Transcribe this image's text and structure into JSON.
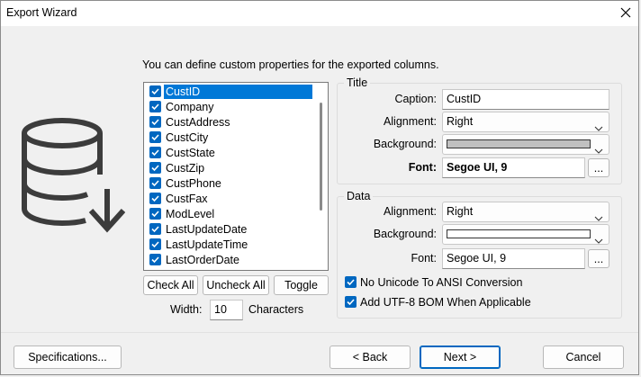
{
  "window": {
    "title": "Export Wizard"
  },
  "intro_text": "You can define custom properties for the exported columns.",
  "columns": [
    {
      "label": "CustID",
      "checked": true,
      "selected": true
    },
    {
      "label": "Company",
      "checked": true
    },
    {
      "label": "CustAddress",
      "checked": true
    },
    {
      "label": "CustCity",
      "checked": true
    },
    {
      "label": "CustState",
      "checked": true
    },
    {
      "label": "CustZip",
      "checked": true
    },
    {
      "label": "CustPhone",
      "checked": true
    },
    {
      "label": "CustFax",
      "checked": true
    },
    {
      "label": "ModLevel",
      "checked": true
    },
    {
      "label": "LastUpdateDate",
      "checked": true
    },
    {
      "label": "LastUpdateTime",
      "checked": true
    },
    {
      "label": "LastOrderDate",
      "checked": true
    }
  ],
  "list_buttons": {
    "check_all": "Check All",
    "uncheck_all": "Uncheck All",
    "toggle": "Toggle"
  },
  "width": {
    "label": "Width:",
    "value": "10",
    "unit": "Characters"
  },
  "title_group": {
    "heading": "Title",
    "caption_label": "Caption:",
    "caption_value": "CustID",
    "alignment_label": "Alignment:",
    "alignment_value": "Right",
    "background_label": "Background:",
    "background_color": "#c0c0c0",
    "font_label": "Font:",
    "font_value": "Segoe UI, 9",
    "browse": "..."
  },
  "data_group": {
    "heading": "Data",
    "alignment_label": "Alignment:",
    "alignment_value": "Right",
    "background_label": "Background:",
    "background_color": "#ffffff",
    "font_label": "Font:",
    "font_value": "Segoe UI, 9",
    "browse": "...",
    "no_unicode_label": "No Unicode To ANSI Conversion",
    "no_unicode_checked": true,
    "utf8_bom_label": "Add UTF-8 BOM When Applicable",
    "utf8_bom_checked": true
  },
  "footer": {
    "specifications": "Specifications...",
    "back": "< Back",
    "next": "Next >",
    "cancel": "Cancel"
  },
  "colors": {
    "accent": "#0067c0",
    "selection": "#0078d7"
  },
  "icons": {
    "close": "close-icon",
    "database_export": "database-export-icon",
    "checkbox": "checkmark-icon",
    "dropdown": "chevron-down-icon"
  }
}
